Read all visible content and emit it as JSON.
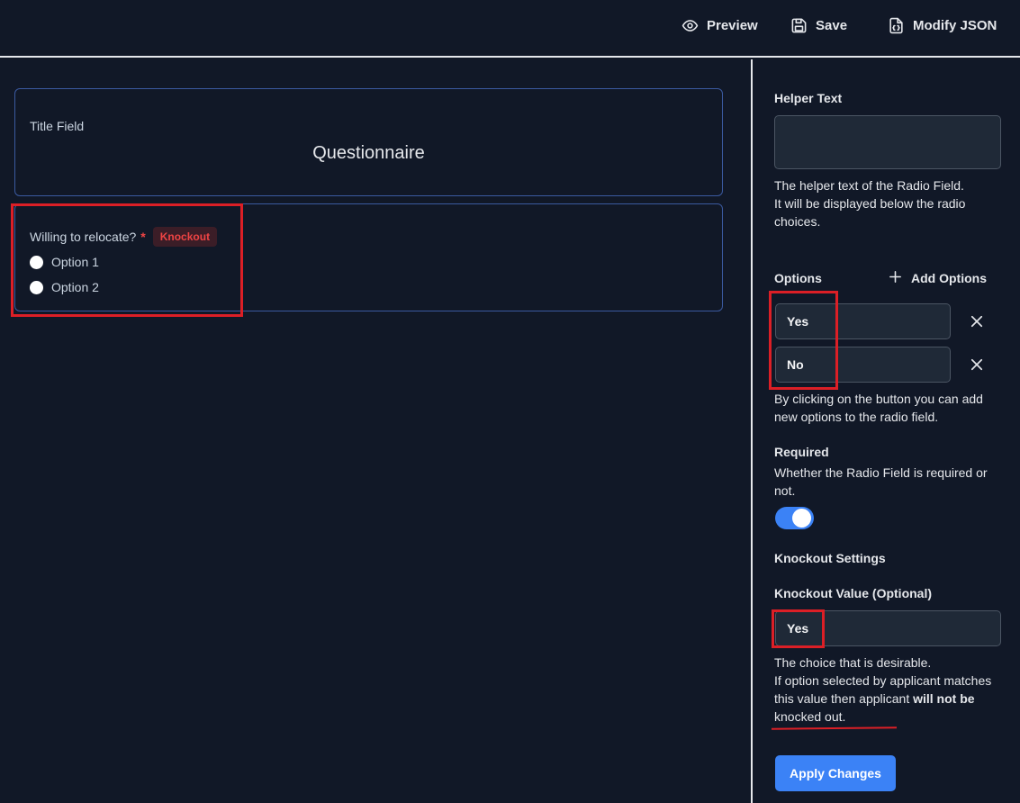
{
  "toolbar": {
    "preview_label": "Preview",
    "save_label": "Save",
    "modify_json_label": "Modify JSON"
  },
  "canvas": {
    "title_field": {
      "label": "Title Field",
      "value": "Questionnaire"
    },
    "radio_field": {
      "question": "Willing to relocate?",
      "required_marker": "*",
      "badge": "Knockout",
      "options": [
        "Option 1",
        "Option 2"
      ]
    }
  },
  "sidebar": {
    "helper_text": {
      "label": "Helper Text",
      "value": "",
      "description_line1": "The helper text of the Radio Field.",
      "description_line2": "It will be displayed below the radio choices."
    },
    "options": {
      "label": "Options",
      "add_label": "Add Options",
      "items": [
        "Yes",
        "No"
      ],
      "description": "By clicking on the button you can add new options to the radio field."
    },
    "required": {
      "label": "Required",
      "description": "Whether the Radio Field is required or not.",
      "enabled": true
    },
    "knockout": {
      "section_label": "Knockout Settings",
      "value_label": "Knockout Value (Optional)",
      "value": "Yes",
      "description_line1": "The choice that is desirable.",
      "description_line2_prefix": "If option selected by applicant matches this value then applicant ",
      "description_line2_bold": "will not be",
      "description_line2_suffix": " knocked out."
    },
    "apply_label": "Apply Changes"
  },
  "colors": {
    "background": "#111827",
    "accent": "#3b82f6",
    "annotation": "#dc1f26",
    "badge_text": "#ef4444"
  }
}
